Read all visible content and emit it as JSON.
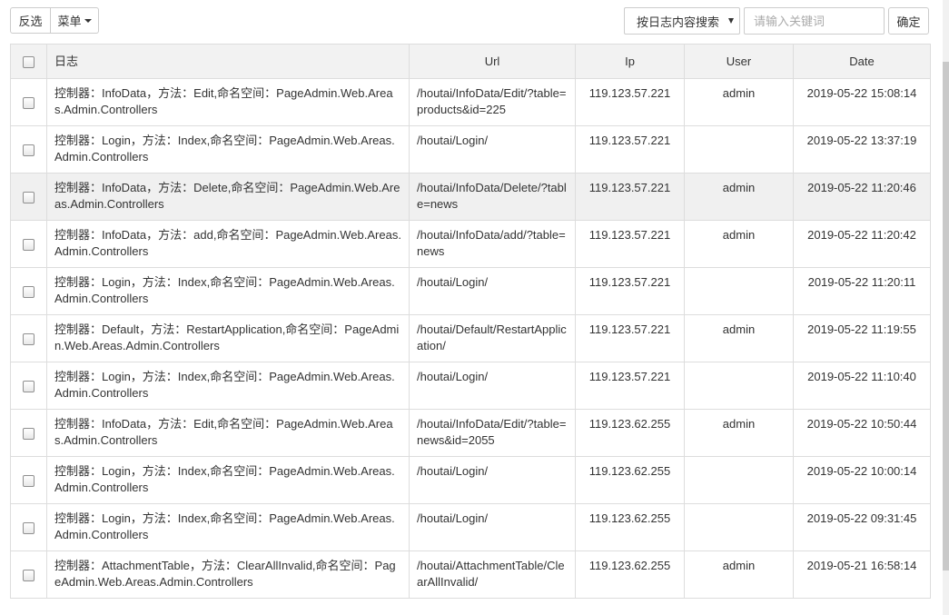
{
  "toolbar": {
    "invert_label": "反选",
    "menu_label": "菜单",
    "search_mode_selected": "按日志内容搜索",
    "keyword_placeholder": "请输入关键词",
    "keyword_value": "",
    "confirm_label": "确定"
  },
  "table": {
    "headers": {
      "log": "日志",
      "url": "Url",
      "ip": "Ip",
      "user": "User",
      "date": "Date"
    },
    "rows": [
      {
        "log": "控制器：InfoData，方法：Edit,命名空间：PageAdmin.Web.Areas.Admin.Controllers",
        "url": "/houtai/InfoData/Edit/?table=products&id=225",
        "ip": "119.123.57.221",
        "user": "admin",
        "date": "2019-05-22 15:08:14"
      },
      {
        "log": "控制器：Login，方法：Index,命名空间：PageAdmin.Web.Areas.Admin.Controllers",
        "url": "/houtai/Login/",
        "ip": "119.123.57.221",
        "user": "",
        "date": "2019-05-22 13:37:19"
      },
      {
        "log": "控制器：InfoData，方法：Delete,命名空间：PageAdmin.Web.Areas.Admin.Controllers",
        "url": "/houtai/InfoData/Delete/?table=news",
        "ip": "119.123.57.221",
        "user": "admin",
        "date": "2019-05-22 11:20:46"
      },
      {
        "log": "控制器：InfoData，方法：add,命名空间：PageAdmin.Web.Areas.Admin.Controllers",
        "url": "/houtai/InfoData/add/?table=news",
        "ip": "119.123.57.221",
        "user": "admin",
        "date": "2019-05-22 11:20:42"
      },
      {
        "log": "控制器：Login，方法：Index,命名空间：PageAdmin.Web.Areas.Admin.Controllers",
        "url": "/houtai/Login/",
        "ip": "119.123.57.221",
        "user": "",
        "date": "2019-05-22 11:20:11"
      },
      {
        "log": "控制器：Default，方法：RestartApplication,命名空间：PageAdmin.Web.Areas.Admin.Controllers",
        "url": "/houtai/Default/RestartApplication/",
        "ip": "119.123.57.221",
        "user": "admin",
        "date": "2019-05-22 11:19:55"
      },
      {
        "log": "控制器：Login，方法：Index,命名空间：PageAdmin.Web.Areas.Admin.Controllers",
        "url": "/houtai/Login/",
        "ip": "119.123.57.221",
        "user": "",
        "date": "2019-05-22 11:10:40"
      },
      {
        "log": "控制器：InfoData，方法：Edit,命名空间：PageAdmin.Web.Areas.Admin.Controllers",
        "url": "/houtai/InfoData/Edit/?table=news&id=2055",
        "ip": "119.123.62.255",
        "user": "admin",
        "date": "2019-05-22 10:50:44"
      },
      {
        "log": "控制器：Login，方法：Index,命名空间：PageAdmin.Web.Areas.Admin.Controllers",
        "url": "/houtai/Login/",
        "ip": "119.123.62.255",
        "user": "",
        "date": "2019-05-22 10:00:14"
      },
      {
        "log": "控制器：Login，方法：Index,命名空间：PageAdmin.Web.Areas.Admin.Controllers",
        "url": "/houtai/Login/",
        "ip": "119.123.62.255",
        "user": "",
        "date": "2019-05-22 09:31:45"
      },
      {
        "log": "控制器：AttachmentTable，方法：ClearAllInvalid,命名空间：PageAdmin.Web.Areas.Admin.Controllers",
        "url": "/houtai/AttachmentTable/ClearAllInvalid/",
        "ip": "119.123.62.255",
        "user": "admin",
        "date": "2019-05-21 16:58:14"
      }
    ]
  }
}
